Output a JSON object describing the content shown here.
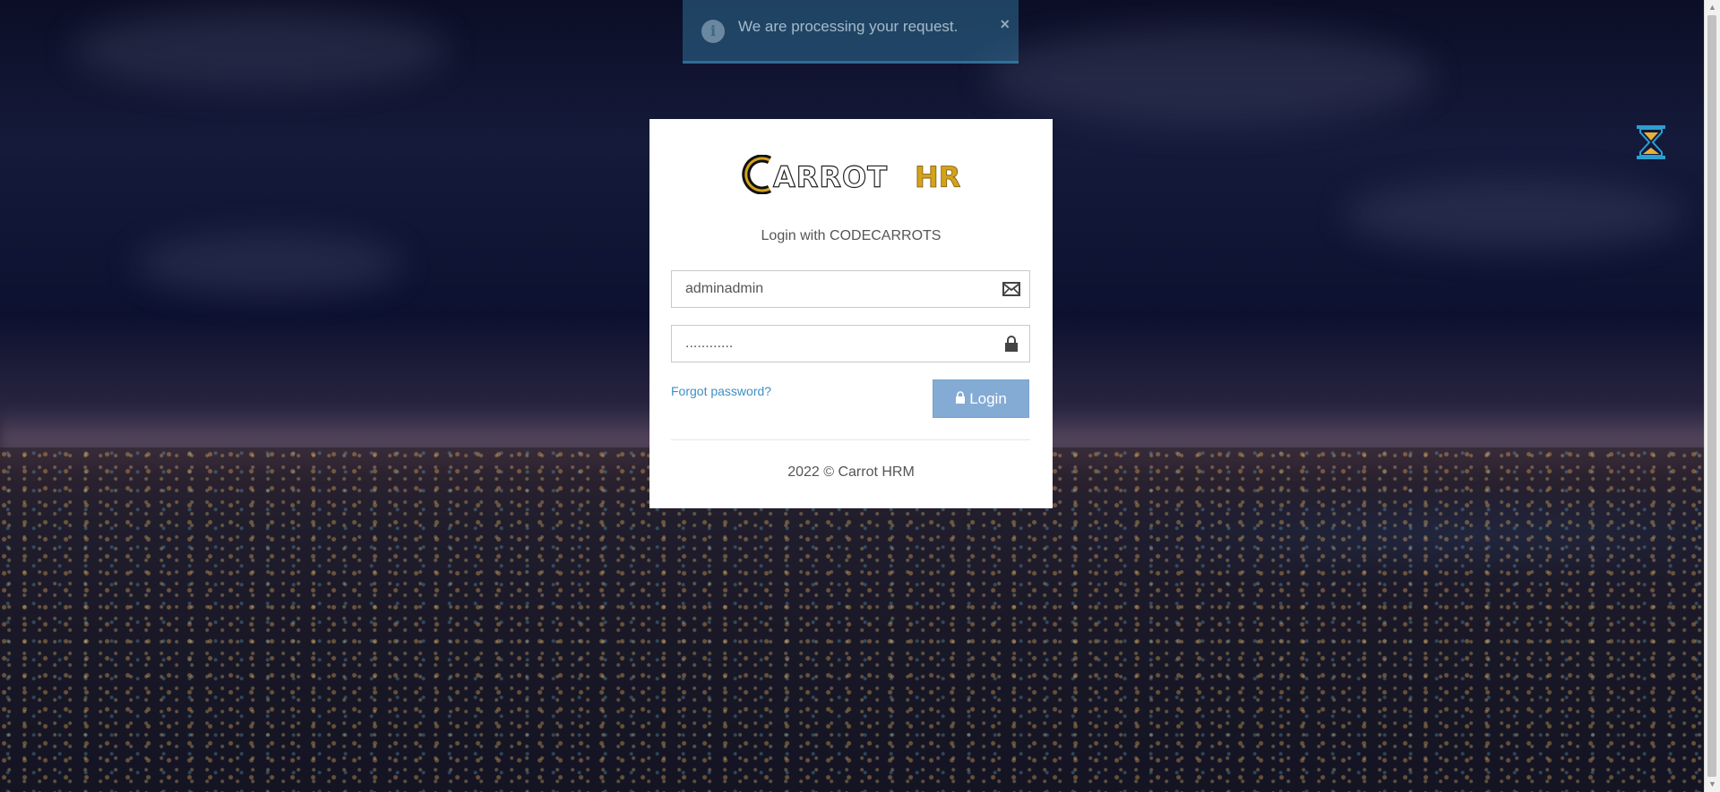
{
  "toast": {
    "message": "We are processing your request.",
    "close_symbol": "×",
    "icon": "info-icon",
    "info_glyph": "i"
  },
  "brand": {
    "logo_prefix": "ARROT",
    "logo_initial": "C",
    "logo_suffix": "HR",
    "accent_color": "#d4a21c"
  },
  "login": {
    "subtitle": "Login with CODECARROTS",
    "username_value": "adminadmin",
    "username_icon": "envelope-icon",
    "password_value": "............",
    "password_icon": "lock-icon",
    "forgot_label": "Forgot password?",
    "submit_label": "Login",
    "submit_icon": "lock-icon",
    "button_color": "#84abd4"
  },
  "footer": {
    "text": "2022 © Carrot HRM"
  },
  "loader": {
    "icon": "hourglass-icon"
  }
}
